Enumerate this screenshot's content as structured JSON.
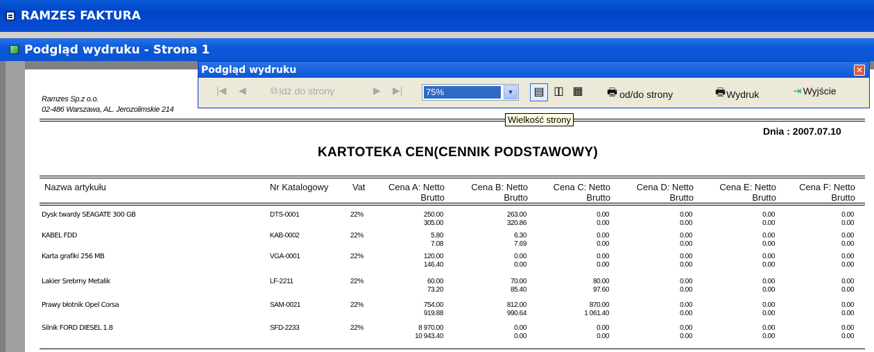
{
  "app": {
    "title": "RAMZES FAKTURA"
  },
  "preview_window": {
    "title": "Podgląd wydruku - Strona 1"
  },
  "toolbar": {
    "title": "Podgląd wydruku",
    "close_glyph": "✕",
    "first_glyph": "|◀",
    "prev_glyph": "◀",
    "goto_label": "Idź do strony",
    "next_glyph": "▶",
    "last_glyph": "▶|",
    "zoom_value": "75%",
    "zoom_arrow": "▾",
    "view_single_glyph": "▤",
    "view_two_glyph": "▯▯",
    "view_four_glyph": "▦",
    "range_label": "od/do strony",
    "print_label": "Wydruk",
    "exit_label": "Wyjście",
    "icons": [
      "first-page-icon",
      "prev-page-icon",
      "goto-icon",
      "next-page-icon",
      "last-page-icon",
      "single-page-icon",
      "two-pages-icon",
      "four-pages-icon",
      "printer-icon",
      "exit-door-icon"
    ]
  },
  "tooltip": {
    "text": "Wielkość strony"
  },
  "report": {
    "company_line1": "Ramzes Sp.z o.o.",
    "company_line2": "02-486 Warszawa, AL. Jerozolimskie 214",
    "date": "Dnia : 2007.07.10",
    "title": "KARTOTEKA CEN(CENNIK PODSTAWOWY)",
    "columns": {
      "name": "Nazwa artykułu",
      "catalog": "Nr Katalogowy",
      "vat": "Vat",
      "a_top": "Cena A:  Netto",
      "a_bottom": "Brutto",
      "b_top": "Cena B:  Netto",
      "b_bottom": "Brutto",
      "c_top": "Cena C:  Netto",
      "c_bottom": "Brutto",
      "d_top": "Cena D:  Netto",
      "d_bottom": "Brutto",
      "e_top": "Cena E:  Netto",
      "e_bottom": "Brutto",
      "f_top": "Cena F:  Netto",
      "f_bottom": "Brutto"
    },
    "rows": [
      {
        "name": "Dysk twardy SEAGATE 300 GB",
        "catalog": "DTS-0001",
        "vat": "22%",
        "prices": [
          [
            "250.00",
            "305.00"
          ],
          [
            "263.00",
            "320.86"
          ],
          [
            "0.00",
            "0.00"
          ],
          [
            "0.00",
            "0.00"
          ],
          [
            "0.00",
            "0.00"
          ],
          [
            "0.00",
            "0.00"
          ]
        ]
      },
      {
        "name": "KABEL FDD",
        "catalog": "KAB-0002",
        "vat": "22%",
        "prices": [
          [
            "5.80",
            "7.08"
          ],
          [
            "6.30",
            "7.69"
          ],
          [
            "0.00",
            "0.00"
          ],
          [
            "0.00",
            "0.00"
          ],
          [
            "0.00",
            "0.00"
          ],
          [
            "0.00",
            "0.00"
          ]
        ]
      },
      {
        "name": "Karta grafiki 256 MB",
        "catalog": "VGA-0001",
        "vat": "22%",
        "prices": [
          [
            "120.00",
            "146.40"
          ],
          [
            "0.00",
            "0.00"
          ],
          [
            "0.00",
            "0.00"
          ],
          [
            "0.00",
            "0.00"
          ],
          [
            "0.00",
            "0.00"
          ],
          [
            "0.00",
            "0.00"
          ]
        ]
      },
      {
        "name": "Lakier Srebrny Metalik",
        "catalog": "LF-2211",
        "vat": "22%",
        "prices": [
          [
            "60.00",
            "73.20"
          ],
          [
            "70.00",
            "85.40"
          ],
          [
            "80.00",
            "97.60"
          ],
          [
            "0.00",
            "0.00"
          ],
          [
            "0.00",
            "0.00"
          ],
          [
            "0.00",
            "0.00"
          ]
        ]
      },
      {
        "name": "Prawy błotnik Opel Corsa",
        "catalog": "SAM-0021",
        "vat": "22%",
        "prices": [
          [
            "754.00",
            "919.88"
          ],
          [
            "812.00",
            "990.64"
          ],
          [
            "870.00",
            "1 061.40"
          ],
          [
            "0.00",
            "0.00"
          ],
          [
            "0.00",
            "0.00"
          ],
          [
            "0.00",
            "0.00"
          ]
        ]
      },
      {
        "name": "Silnik FORD DIESEL 1.8",
        "catalog": "SFD-2233",
        "vat": "22%",
        "prices": [
          [
            "8 970.00",
            "10 943.40"
          ],
          [
            "0.00",
            "0.00"
          ],
          [
            "0.00",
            "0.00"
          ],
          [
            "0.00",
            "0.00"
          ],
          [
            "0.00",
            "0.00"
          ],
          [
            "0.00",
            "0.00"
          ]
        ]
      }
    ]
  }
}
